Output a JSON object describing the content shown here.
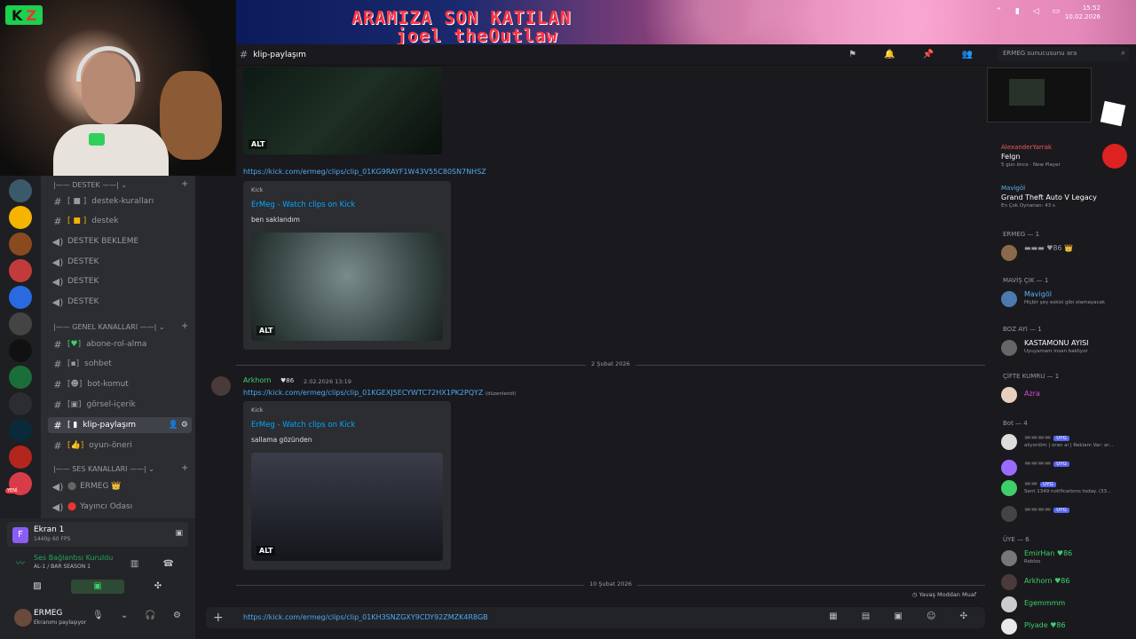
{
  "banner": {
    "line1": "ARAMIZA SON KATILAN",
    "line2": "joel_theOutlaw",
    "time": "15:52",
    "date": "10.02.2026"
  },
  "webcam": {
    "badge": "K"
  },
  "server_rail": {
    "new_badge": "YENİ"
  },
  "channels": {
    "categories": [
      "DESTEK",
      "GENEL KANALLARI",
      "SES KANALLARI"
    ],
    "items": [
      {
        "prefix": "#",
        "label": "destek-kuralları"
      },
      {
        "prefix": "#",
        "label": "destek"
      },
      {
        "prefix": "🔊",
        "label": "DESTEK BEKLEME"
      },
      {
        "prefix": "🔊",
        "label": "DESTEK"
      },
      {
        "prefix": "🔊",
        "label": "DESTEK"
      },
      {
        "prefix": "🔊",
        "label": "DESTEK"
      },
      {
        "prefix": "#",
        "label": "abone-rol-alma"
      },
      {
        "prefix": "#",
        "label": "sohbet"
      },
      {
        "prefix": "#",
        "label": "bot-komut"
      },
      {
        "prefix": "#",
        "label": "görsel-içerik"
      },
      {
        "prefix": "#",
        "label": "klip-paylaşım"
      },
      {
        "prefix": "#",
        "label": "oyun-öneri"
      },
      {
        "prefix": "🔊",
        "label": "ERMEG 👑"
      },
      {
        "prefix": "🔊",
        "label": "Yayıncı Odası"
      }
    ]
  },
  "user_panel": {
    "screen_title": "Ekran 1",
    "screen_sub": "1440p 60 FPS",
    "voice_status": "Ses Bağlantısı Kuruldu",
    "voice_channel": "AL-1 / BAR SEASON 1",
    "username": "ERMEG",
    "user_status": "Ekranımı paylaşıyor"
  },
  "chat": {
    "channel_title": "klip-paylaşım",
    "search_placeholder": "ERMEG sunucusunu ara",
    "messages": {
      "m1_link": "https://kick.com/ermeg/clips/clip_01KG9RAYF1W43V55C80SN7NHSZ",
      "m1_embed_provider": "Kick",
      "m1_embed_title": "ErMeg - Watch clips on Kick",
      "m1_embed_desc": "ben saklandım",
      "alt_label": "ALT",
      "date_divider": "2 Şubat 2026",
      "m2_author": "Arkhorn",
      "m2_badge": "86",
      "m2_time": "2.02.2026 13:19",
      "m2_link": "https://kick.com/ermeg/clips/clip_01KGEXJ5ECYWTC72HX1PK2PQYZ",
      "m2_edited": "(düzenlendi)",
      "m2_embed_provider": "Kick",
      "m2_embed_title": "ErMeg - Watch clips on Kick",
      "m2_embed_desc": "sallama gözünden",
      "bottom_divider": "10 Şubat 2026"
    },
    "slowmode": "Yavaş Moddan Muaf",
    "composer_value": "https://kick.com/ermeg/clips/clip_01KH3SNZGXY9CDY92ZMZK4R8GB"
  },
  "members": {
    "activity1": {
      "name": "AlexanderYarrak",
      "game": "Felgn",
      "sub": "5 gün önce · New Player"
    },
    "activity2": {
      "name": "Mavigöl",
      "game": "Grand Theft Auto V Legacy",
      "sub": "En Çok Oynanan: 43 s"
    },
    "groups": [
      {
        "title": "ERMEG — 1"
      },
      {
        "title": "MAVİŞ ÇIK — 1"
      },
      {
        "title": "BOZ AYI — 1"
      },
      {
        "title": "ÇİFTE KUMRU — 1"
      },
      {
        "title": "Bot — 4"
      },
      {
        "title": "ÜYE — 6"
      }
    ],
    "mavis": {
      "name": "Mavigöl",
      "status": "Hiçbir şey eskisi gibi olamayacak"
    },
    "bozayi": {
      "name": "KASTAMONU AYISI",
      "status": "Uyuyamam insan bakliyor"
    },
    "ciftekumru": {
      "name": "Azra"
    },
    "bot_app": "UYG",
    "bot_status1": "aliyordim | oran al | Reklam Var: ar...",
    "bot_status2": "Sent 1349 notifications today. (33...",
    "uyeler": [
      {
        "name": "EmirHan",
        "badge": "86",
        "status": "Roblox"
      },
      {
        "name": "Arkhorn",
        "badge": "86",
        "status": ""
      },
      {
        "name": "Egemmmm",
        "badge": "",
        "status": ""
      },
      {
        "name": "Plyade",
        "badge": "86",
        "status": ""
      }
    ]
  },
  "colors": {
    "accent": "#5865f2",
    "link": "#4ca9f5",
    "online": "#23a55a"
  }
}
